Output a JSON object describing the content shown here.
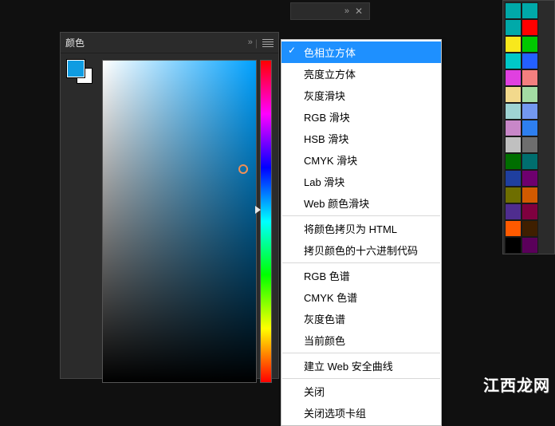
{
  "mini_tab": {},
  "color_panel": {
    "title": "颜色",
    "foreground_hex": "#0f9ce2",
    "background_hex": "#ffffff"
  },
  "menu": {
    "groups": [
      [
        {
          "label": "色相立方体",
          "checked": true,
          "selected": true
        },
        {
          "label": "亮度立方体"
        },
        {
          "label": "灰度滑块"
        },
        {
          "label": "RGB 滑块"
        },
        {
          "label": "HSB 滑块"
        },
        {
          "label": "CMYK 滑块"
        },
        {
          "label": "Lab 滑块"
        },
        {
          "label": "Web 颜色滑块"
        }
      ],
      [
        {
          "label": "将颜色拷贝为 HTML"
        },
        {
          "label": "拷贝颜色的十六进制代码"
        }
      ],
      [
        {
          "label": "RGB 色谱"
        },
        {
          "label": "CMYK 色谱"
        },
        {
          "label": "灰度色谱"
        },
        {
          "label": "当前颜色"
        }
      ],
      [
        {
          "label": "建立 Web 安全曲线"
        }
      ],
      [
        {
          "label": "关闭"
        },
        {
          "label": "关闭选项卡组"
        }
      ]
    ]
  },
  "swatches": [
    "#00a9a9",
    "#00a9a9",
    "#00a9a9",
    "#ff0000",
    "#f8e81c",
    "#00c800",
    "#00c8c8",
    "#2460ff",
    "#e040e0",
    "#f37f7f",
    "#f2d98c",
    "#a3dca3",
    "#9ed3d3",
    "#7398f0",
    "#c887c8",
    "#2e7fef",
    "#c0c0c0",
    "#6e6e6e",
    "#006e00",
    "#006e6e",
    "#1f3f9f",
    "#6e006e",
    "#6e6e00",
    "#d15a00",
    "#4f2d8f",
    "#7f003f",
    "#ff5a00",
    "#3f1f00",
    "#000000",
    "#5a005a"
  ],
  "watermark": "江西龙网"
}
